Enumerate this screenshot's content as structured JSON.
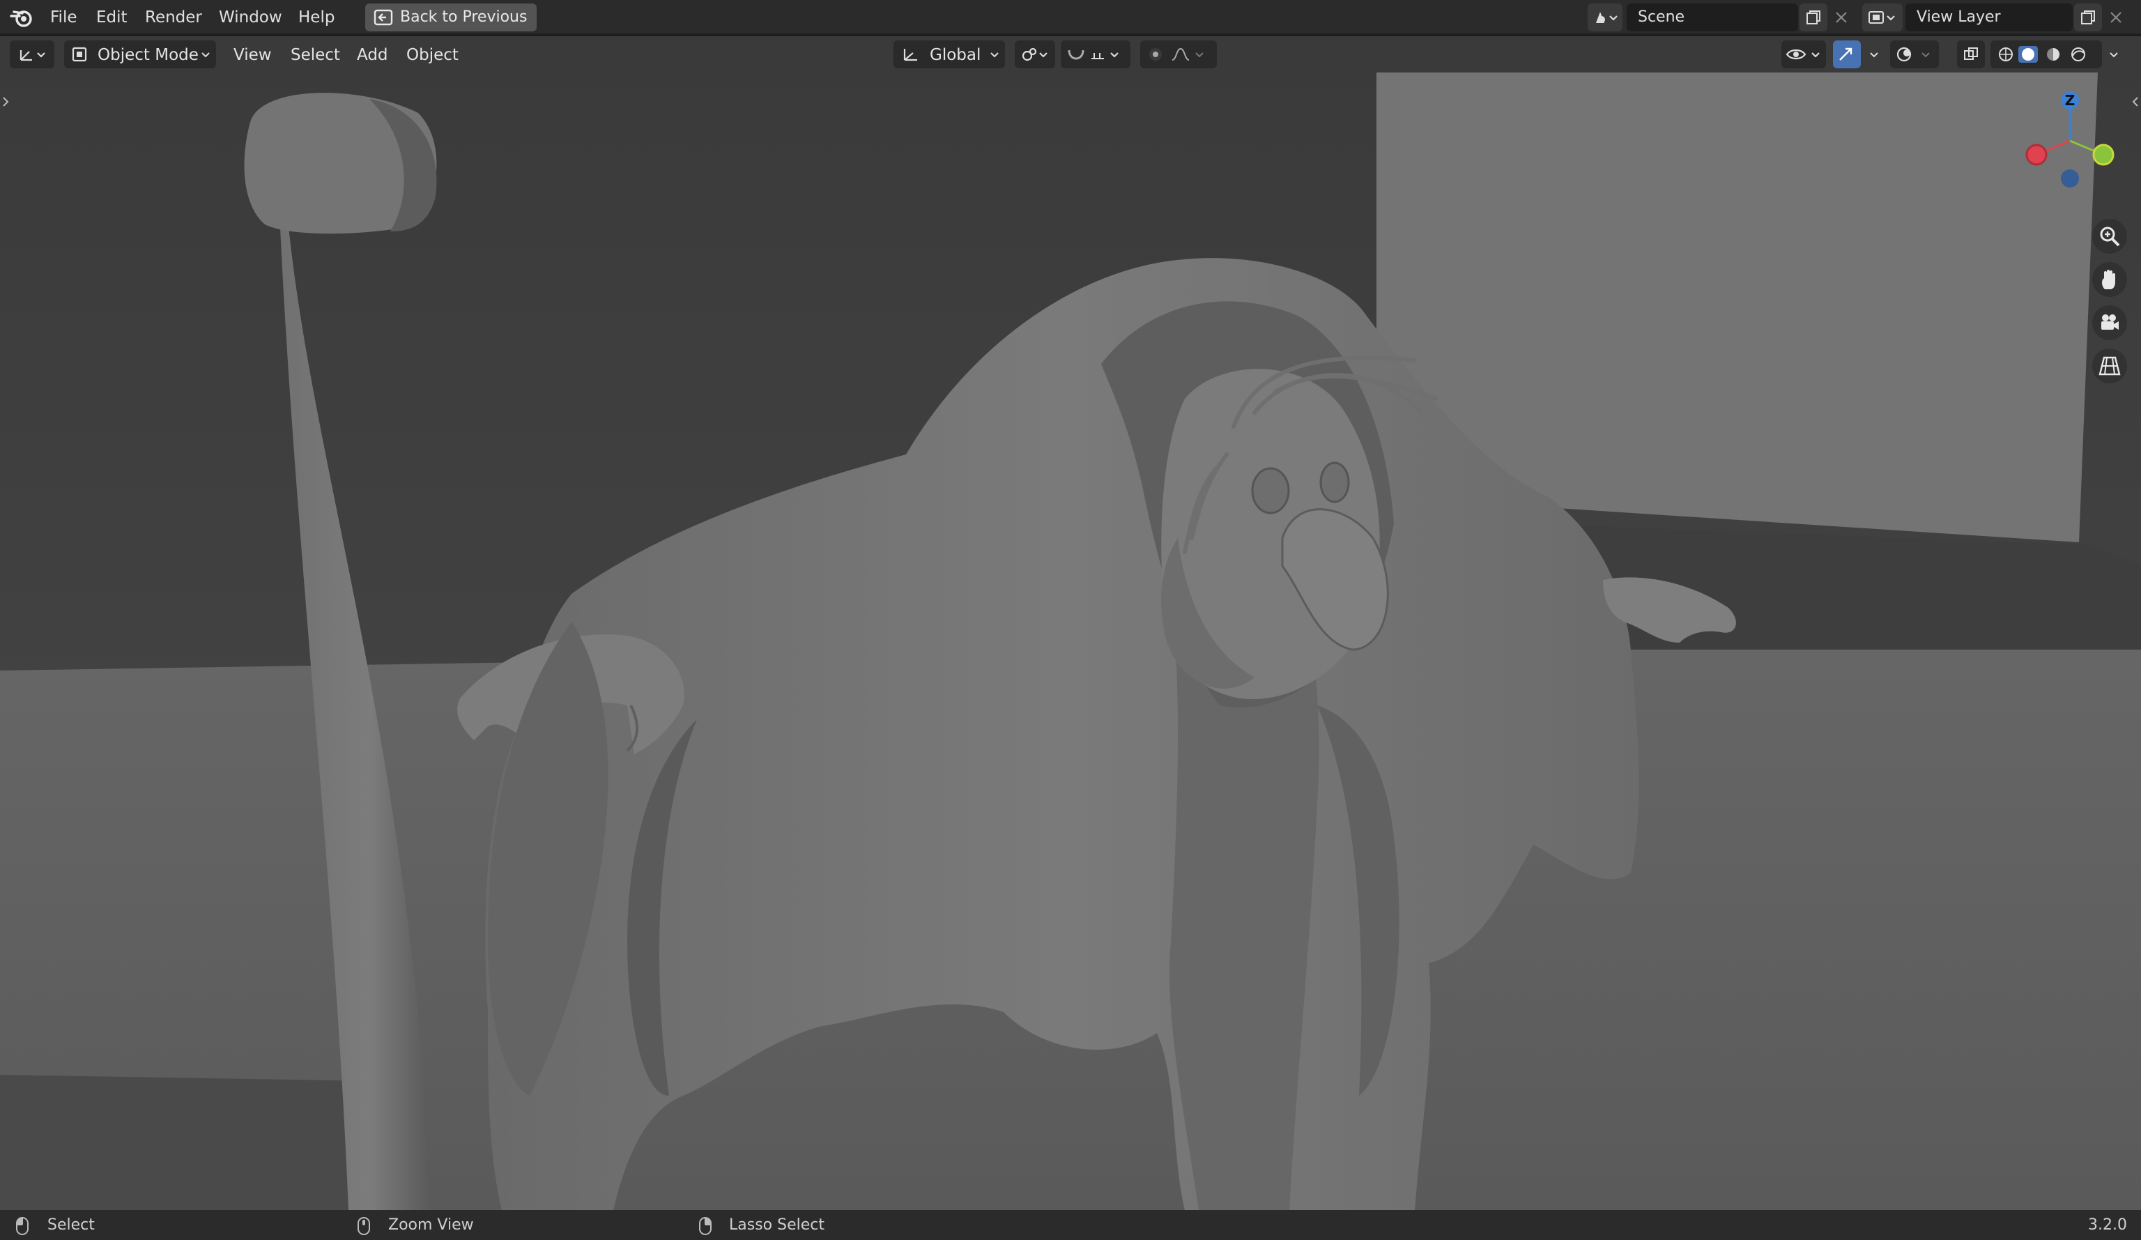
{
  "app": {
    "name": "Blender",
    "version": "3.2.0"
  },
  "menubar": {
    "items": [
      "File",
      "Edit",
      "Render",
      "Window",
      "Help"
    ],
    "back_button": "Back to Previous",
    "scene": "Scene",
    "view_layer": "View Layer"
  },
  "viewport_header": {
    "mode": "Object Mode",
    "menus": [
      "View",
      "Select",
      "Add",
      "Object"
    ],
    "transform_orientation": "Global"
  },
  "gizmo": {
    "z_label": "Z"
  },
  "icons": {
    "logo": "blender-logo-icon",
    "back": "back-arrow-icon",
    "zoom": "zoom-icon",
    "pan": "hand-icon",
    "camera": "camera-icon",
    "ortho": "grid-icon"
  },
  "statusbar": {
    "select": "Select",
    "zoom_view": "Zoom View",
    "lasso_select": "Lasso Select"
  },
  "colors": {
    "axis_x": "#e0424f",
    "axis_y": "#8ac43a",
    "axis_z": "#3b82d6",
    "accent": "#4772b3"
  }
}
